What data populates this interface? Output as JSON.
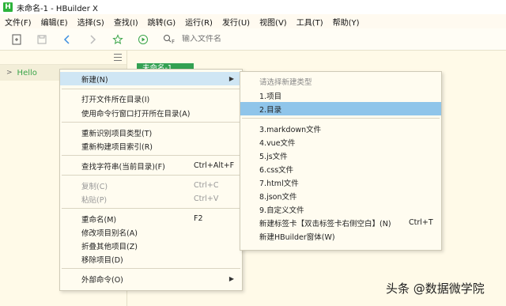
{
  "window": {
    "title": "未命名-1 - HBuilder X",
    "app_icon_letter": "H"
  },
  "menubar": [
    "文件(F)",
    "编辑(E)",
    "选择(S)",
    "查找(I)",
    "跳转(G)",
    "运行(R)",
    "发行(U)",
    "视图(V)",
    "工具(T)",
    "帮助(Y)"
  ],
  "toolbar": {
    "search_placeholder": "输入文件名",
    "search_icon_letter": "F"
  },
  "sidebar": {
    "project": "Hello"
  },
  "editor": {
    "tab": "未命名-1"
  },
  "context_menu": {
    "items": [
      {
        "label": "新建(N)",
        "shortcut": "",
        "submenu": true
      },
      {
        "label": "打开文件所在目录(I)",
        "shortcut": ""
      },
      {
        "label": "使用命令行窗口打开所在目录(A)",
        "shortcut": ""
      },
      {
        "label": "重新识别项目类型(T)",
        "shortcut": ""
      },
      {
        "label": "重新构建项目索引(R)",
        "shortcut": ""
      },
      {
        "label": "查找字符串(当前目录)(F)",
        "shortcut": "Ctrl+Alt+F"
      },
      {
        "label": "复制(C)",
        "shortcut": "Ctrl+C"
      },
      {
        "label": "粘贴(P)",
        "shortcut": "Ctrl+V"
      },
      {
        "label": "重命名(M)",
        "shortcut": "F2"
      },
      {
        "label": "修改项目别名(A)",
        "shortcut": ""
      },
      {
        "label": "折叠其他项目(Z)",
        "shortcut": ""
      },
      {
        "label": "移除项目(D)",
        "shortcut": ""
      },
      {
        "label": "外部命令(O)",
        "shortcut": "",
        "submenu": true
      }
    ]
  },
  "submenu": {
    "items": [
      {
        "label": "请选择新建类型",
        "shortcut": ""
      },
      {
        "label": "1.项目",
        "shortcut": ""
      },
      {
        "label": "2.目录",
        "shortcut": ""
      },
      {
        "label": "3.markdown文件",
        "shortcut": ""
      },
      {
        "label": "4.vue文件",
        "shortcut": ""
      },
      {
        "label": "5.js文件",
        "shortcut": ""
      },
      {
        "label": "6.css文件",
        "shortcut": ""
      },
      {
        "label": "7.html文件",
        "shortcut": ""
      },
      {
        "label": "8.json文件",
        "shortcut": ""
      },
      {
        "label": "9.自定义文件",
        "shortcut": ""
      },
      {
        "label": "新建标签卡【双击标签卡右侧空白】(N)",
        "shortcut": "Ctrl+T"
      },
      {
        "label": "新建HBuilder窗体(W)",
        "shortcut": ""
      }
    ]
  },
  "watermark": "头条 @数据微学院",
  "colors": {
    "accent_green": "#33a152",
    "highlight_blue": "#8fc5ea",
    "hover_blue": "#cfe6f4",
    "editor_bg": "#fffae8"
  }
}
